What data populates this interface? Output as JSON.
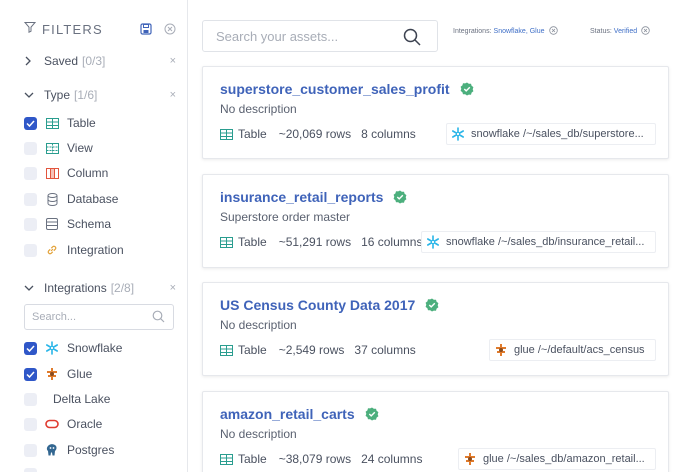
{
  "sidebar": {
    "title": "FILTERS",
    "saved": {
      "label": "Saved",
      "count": "[0/3]"
    },
    "type": {
      "label": "Type",
      "count": "[1/6]",
      "options": [
        {
          "label": "Table",
          "checked": true,
          "icon": "table-icon"
        },
        {
          "label": "View",
          "checked": false,
          "icon": "view-icon"
        },
        {
          "label": "Column",
          "checked": false,
          "icon": "column-icon"
        },
        {
          "label": "Database",
          "checked": false,
          "icon": "database-icon"
        },
        {
          "label": "Schema",
          "checked": false,
          "icon": "schema-icon"
        },
        {
          "label": "Integration",
          "checked": false,
          "icon": "integration-icon"
        }
      ]
    },
    "integrations": {
      "label": "Integrations",
      "count": "[2/8]",
      "search_placeholder": "Search...",
      "options": [
        {
          "label": "Snowflake",
          "checked": true,
          "icon": "snowflake-icon"
        },
        {
          "label": "Glue",
          "checked": true,
          "icon": "glue-icon"
        },
        {
          "label": "Delta Lake",
          "checked": false,
          "icon": "delta-lake-icon"
        },
        {
          "label": "Oracle",
          "checked": false,
          "icon": "oracle-icon"
        },
        {
          "label": "Postgres",
          "checked": false,
          "icon": "postgres-icon"
        }
      ]
    }
  },
  "search": {
    "placeholder": "Search your assets..."
  },
  "chips": [
    {
      "label": "Integrations:",
      "value": "Snowflake, Glue"
    },
    {
      "label": "Status:",
      "value": "Verified"
    }
  ],
  "results": [
    {
      "name": "superstore_customer_sales_profit",
      "description": "No description",
      "type": "Table",
      "rows": "~20,069 rows",
      "columns": "8 columns",
      "source": "snowflake /~/sales_db/superstore...",
      "source_icon": "snowflake-icon"
    },
    {
      "name": "insurance_retail_reports",
      "description": "Superstore order master",
      "type": "Table",
      "rows": "~51,291 rows",
      "columns": "16 columns",
      "source": "snowflake /~/sales_db/insurance_retail...",
      "source_icon": "snowflake-icon"
    },
    {
      "name": "US Census County Data 2017",
      "description": "No description",
      "type": "Table",
      "rows": "~2,549 rows",
      "columns": "37 columns",
      "source": "glue /~/default/acs_census",
      "source_icon": "glue-icon"
    },
    {
      "name": "amazon_retail_carts",
      "description": "No description",
      "type": "Table",
      "rows": "~38,079 rows",
      "columns": "24 columns",
      "source": "glue /~/sales_db/amazon_retail...",
      "source_icon": "glue-icon"
    }
  ],
  "colors": {
    "accent": "#2f57c8",
    "link": "#3f63b9",
    "verified": "#4caf7d",
    "snowflake": "#29b5e8",
    "glue": "#e07b2c"
  }
}
